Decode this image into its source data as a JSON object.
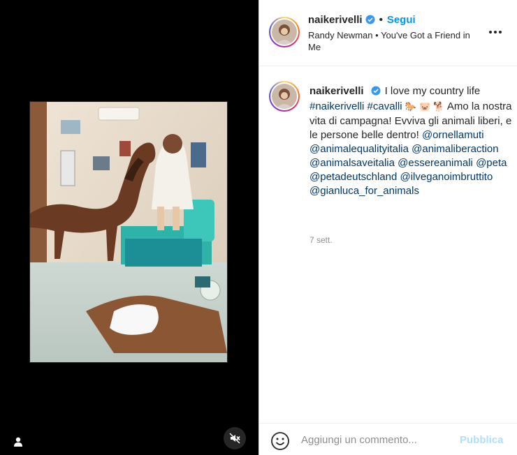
{
  "post": {
    "username": "naikerivelli",
    "follow_label": "Segui",
    "separator": "•",
    "music": {
      "artist": "Randy Newman",
      "separator": "•",
      "song": "You've Got a Friend in Me"
    },
    "caption": {
      "username": "naikerivelli",
      "text_intro": "I love my country life",
      "hashtags": [
        "#naikerivelli",
        "#cavalli"
      ],
      "emojis": "🐎 🐷 🐕",
      "text_body": "Amo la nostra vita di campagna! Evviva gli animali liberi, e le persone belle dentro!",
      "mentions": [
        "@ornellamuti",
        "@animalequalityitalia",
        "@animaliberaction",
        "@animalsaveitalia",
        "@essereanimali",
        "@peta",
        "@petadeutschland",
        "@ilveganoimbruttito",
        "@gianluca_for_animals"
      ]
    },
    "time": "7 sett."
  },
  "comment_bar": {
    "placeholder": "Aggiungi un commento...",
    "publish_label": "Pubblica"
  },
  "colors": {
    "accent": "#0095f6",
    "link": "#00376b",
    "verified": "#3897f0",
    "publish_disabled": "#b2dffc",
    "media_bg": "#000000"
  },
  "icons": {
    "verified": "verified-badge-icon",
    "more": "more-options-icon",
    "mute": "speaker-muted-icon",
    "user_tag": "user-tag-icon",
    "emoji": "emoji-smiley-icon"
  }
}
